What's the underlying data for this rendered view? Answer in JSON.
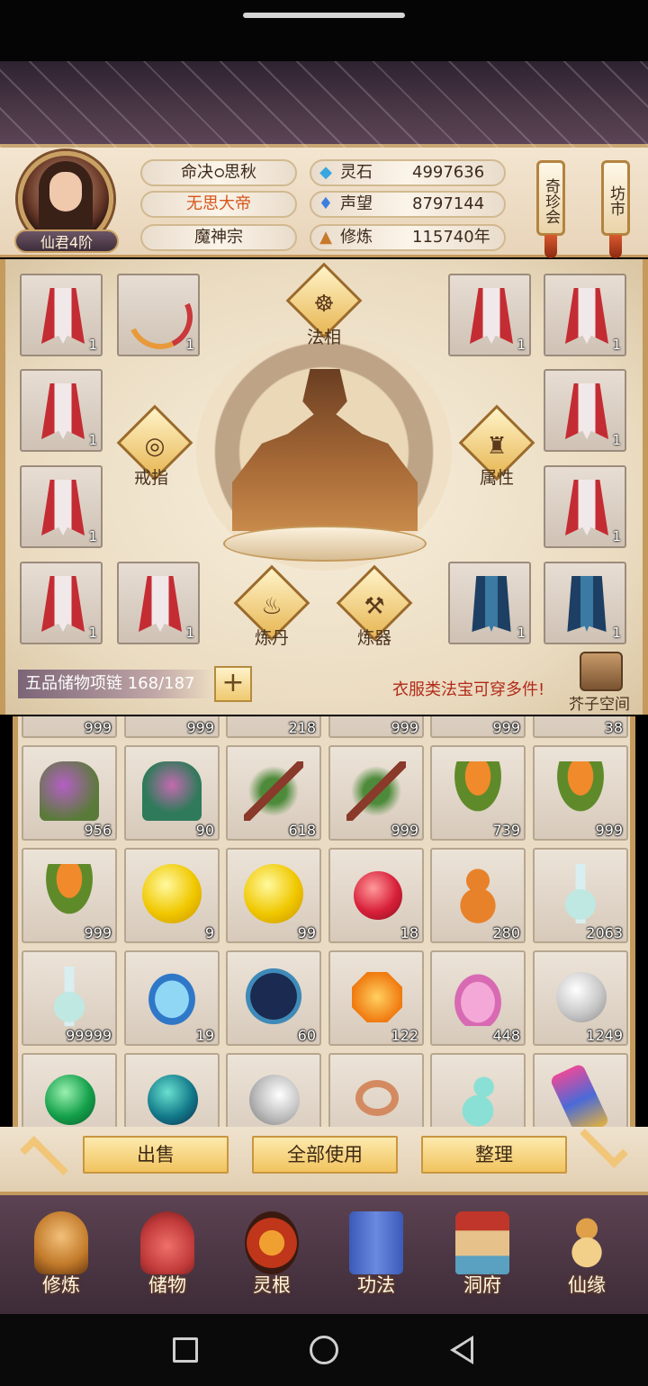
{
  "player": {
    "rank": "仙君4阶",
    "title": "命决ഠ思秋",
    "honor": "无思大帝",
    "sect": "魔神宗"
  },
  "resources": [
    {
      "label": "灵石",
      "value": "4997636",
      "icon": "spirit-stone-icon"
    },
    {
      "label": "声望",
      "value": "8797144",
      "icon": "prestige-icon"
    },
    {
      "label": "修炼",
      "value": "115740年",
      "icon": "cultivation-icon"
    }
  ],
  "side_tags": [
    "奇珍会",
    "坊市"
  ],
  "equipment": {
    "slots_left": [
      {
        "type": "robe-red",
        "count": "1"
      },
      {
        "type": "bow",
        "count": "1"
      },
      {
        "type": "robe-red",
        "count": "1"
      },
      {
        "type": "robe-red",
        "count": "1"
      },
      {
        "type": "robe-red",
        "count": "1"
      },
      {
        "type": "robe-red",
        "count": "1"
      }
    ],
    "slots_right": [
      {
        "type": "robe-red",
        "count": "1"
      },
      {
        "type": "robe-red",
        "count": "1"
      },
      {
        "type": "robe-red",
        "count": "1"
      },
      {
        "type": "robe-red",
        "count": "1"
      },
      {
        "type": "robe-blue",
        "count": "1"
      },
      {
        "type": "robe-blue",
        "count": "1"
      }
    ],
    "functions": {
      "faxiang": "法相",
      "ring": "戒指",
      "attribute": "属性",
      "alchemy": "炼丹",
      "forge": "炼器"
    }
  },
  "bag": {
    "name": "五品储物项链 168/187",
    "hint": "衣服类法宝可穿多件!",
    "space_label": "芥子空间"
  },
  "inventory": {
    "top_partial": [
      "999",
      "999",
      "218",
      "999",
      "999",
      "38"
    ],
    "rows": [
      [
        {
          "item": "purple-herb",
          "count": "956"
        },
        {
          "item": "green-herb",
          "count": "90"
        },
        {
          "item": "red-berry-branch",
          "count": "618"
        },
        {
          "item": "red-berry-branch",
          "count": "999"
        },
        {
          "item": "lotus-pod",
          "count": "739"
        },
        {
          "item": "lotus-pod",
          "count": "999"
        }
      ],
      [
        {
          "item": "lotus-pod",
          "count": "999"
        },
        {
          "item": "yellow-orb",
          "count": "9"
        },
        {
          "item": "yellow-orb",
          "count": "99"
        },
        {
          "item": "red-orb",
          "count": "18"
        },
        {
          "item": "gourd",
          "count": "280"
        },
        {
          "item": "potion-bottle",
          "count": "2063"
        }
      ],
      [
        {
          "item": "potion-bottle",
          "count": "99999"
        },
        {
          "item": "herb-bowl",
          "count": "19"
        },
        {
          "item": "star-chart",
          "count": "60"
        },
        {
          "item": "orange-gem",
          "count": "122"
        },
        {
          "item": "pink-lotus",
          "count": "448"
        },
        {
          "item": "white-orb",
          "count": "1249"
        }
      ],
      [
        {
          "item": "green-orb",
          "count": ""
        },
        {
          "item": "teal-orb",
          "count": ""
        },
        {
          "item": "silver-moon",
          "count": ""
        },
        {
          "item": "ring",
          "count": ""
        },
        {
          "item": "jade-gourd",
          "count": ""
        },
        {
          "item": "scroll",
          "count": ""
        }
      ]
    ]
  },
  "actions": {
    "sell": "出售",
    "use_all": "全部使用",
    "sort": "整理"
  },
  "nav": [
    "修炼",
    "储物",
    "灵根",
    "功法",
    "洞府",
    "仙缘"
  ],
  "colors": {
    "accent_gold": "#f1c45f",
    "hint_red": "#b22a1a",
    "panel": "#eadcc4"
  }
}
